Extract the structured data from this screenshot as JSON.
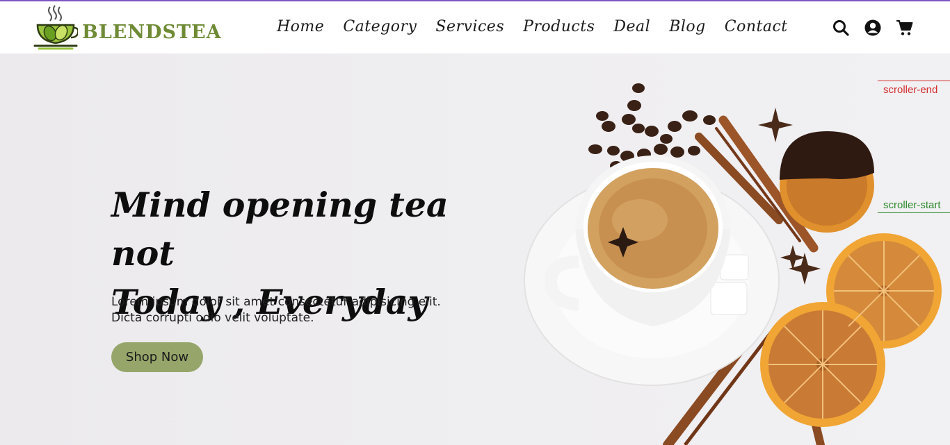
{
  "brand": {
    "name": "BLENDSTEA",
    "logo_icon": "tea-cup-leaf-icon",
    "accent": "#6f8a35"
  },
  "nav": {
    "items": [
      {
        "label": "Home"
      },
      {
        "label": "Category"
      },
      {
        "label": "Services"
      },
      {
        "label": "Products"
      },
      {
        "label": "Deal"
      },
      {
        "label": "Blog"
      },
      {
        "label": "Contact"
      }
    ]
  },
  "header_icons": [
    "search-icon",
    "user-icon",
    "cart-icon"
  ],
  "hero": {
    "headline_line1": "Mind opening tea not",
    "headline_line2": "Today , Everyday",
    "description_line1": "Lorem ipsum dolor sit amet consectetur adipisicing elit.",
    "description_line2": "Dicta corrupti odio velit voluptate.",
    "button_label": "Shop Now",
    "button_color": "#96a66a"
  },
  "markers": {
    "end": "scroller-end",
    "start": "scroller-start"
  }
}
